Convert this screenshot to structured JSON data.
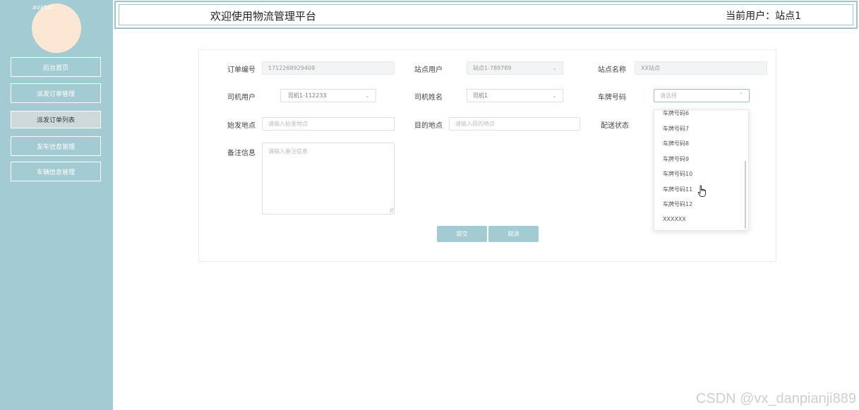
{
  "sidebar": {
    "avatar_alt": "avatar",
    "items": [
      {
        "label": "后台首页"
      },
      {
        "label": "派发订单管理"
      },
      {
        "label": "派发订单列表"
      },
      {
        "label": "发车信息管理"
      },
      {
        "label": "车辆信息管理"
      }
    ]
  },
  "header": {
    "title": "欢迎使用物流管理平台",
    "user": "当前用户：站点1"
  },
  "form": {
    "order_no": {
      "label": "订单编号",
      "value": "1712268929409"
    },
    "station_user": {
      "label": "站点用户",
      "value": "站点1-789789"
    },
    "station_name": {
      "label": "站点名称",
      "value": "XX站点"
    },
    "driver_user": {
      "label": "司机用户",
      "value": "司机1-112233"
    },
    "driver_name": {
      "label": "司机姓名",
      "value": "司机1"
    },
    "plate_no": {
      "label": "车牌号码",
      "placeholder": "请选择"
    },
    "origin": {
      "label": "始发地点",
      "placeholder": "请输入始发地点"
    },
    "destination": {
      "label": "目的地点",
      "placeholder": "请输入目的地点"
    },
    "delivery_status": {
      "label": "配送状态"
    },
    "remark": {
      "label": "备注信息",
      "placeholder": "请输入备注信息"
    },
    "submit_label": "提交",
    "cancel_label": "取消"
  },
  "dropdown": {
    "options": [
      "车牌号码6",
      "车牌号码7",
      "车牌号码8",
      "车牌号码9",
      "车牌号码10",
      "车牌号码11",
      "车牌号码12",
      "XXXXXX"
    ]
  },
  "watermark": "CSDN @vx_danpianji889",
  "colors": {
    "sidebar": "#a3cbd4",
    "accent": "#a3cbd4",
    "header_border": "#9cc5cf",
    "avatar": "#fbe7d3"
  }
}
